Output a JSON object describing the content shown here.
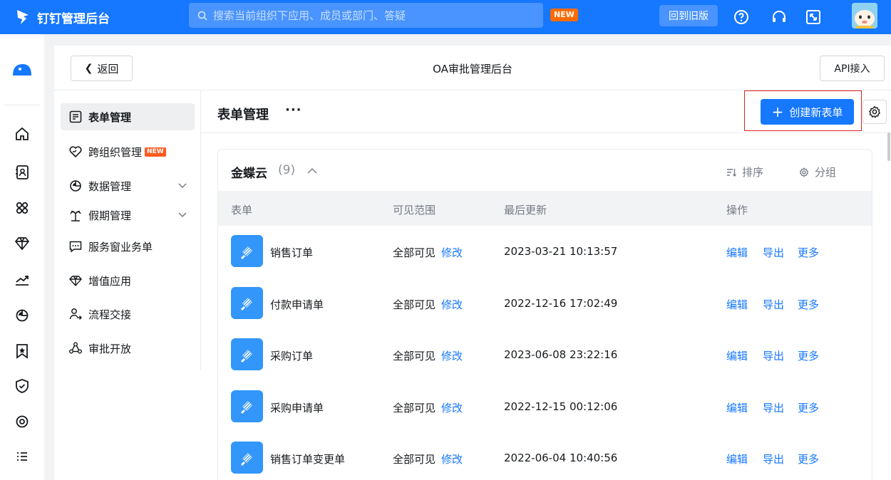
{
  "topbar": {
    "brand": "钉钉管理后台",
    "search_placeholder": "搜索当前组织下应用、成员或部门、答疑",
    "new_badge": "NEW",
    "old_version_label": "回到旧版",
    "icons": [
      "help-icon",
      "headset-icon",
      "fullscreen-icon"
    ],
    "accent_color": "#1677ff"
  },
  "rail": {
    "icons": [
      "home-icon",
      "contacts-icon",
      "apps-icon",
      "diamond-icon",
      "trend-icon",
      "pie-icon",
      "bookmark-icon",
      "shield-icon",
      "target-icon",
      "list-icon"
    ]
  },
  "header": {
    "back_label": "返回",
    "title": "OA审批管理后台",
    "api_label": "API接入"
  },
  "subnav": {
    "items": [
      {
        "label": "表单管理",
        "icon": "form-icon",
        "active": true
      },
      {
        "label": "跨组织管理",
        "icon": "heart-link-icon",
        "badge": "NEW"
      },
      {
        "label": "数据管理",
        "icon": "chart-icon",
        "expandable": true
      },
      {
        "label": "假期管理",
        "icon": "palm-icon",
        "expandable": true
      },
      {
        "label": "服务窗业务单",
        "icon": "chat-icon"
      },
      {
        "label": "增值应用",
        "icon": "diamond-icon"
      },
      {
        "label": "流程交接",
        "icon": "user-transfer-icon"
      },
      {
        "label": "审批开放",
        "icon": "network-icon"
      }
    ]
  },
  "content": {
    "title": "表单管理",
    "more": "···",
    "create_label": "创建新表单",
    "group": {
      "name": "金蝶云",
      "count": "(9)",
      "sort_label": "排序",
      "group_label": "分组",
      "columns": [
        "表单",
        "可见范围",
        "最后更新",
        "操作"
      ],
      "rows": [
        {
          "name": "销售订单",
          "scope": "全部可见",
          "modify": "修改",
          "updated": "2023-03-21 10:13:57",
          "edit": "编辑",
          "export": "导出",
          "more": "更多"
        },
        {
          "name": "付款申请单",
          "scope": "全部可见",
          "modify": "修改",
          "updated": "2022-12-16 17:02:49",
          "edit": "编辑",
          "export": "导出",
          "more": "更多"
        },
        {
          "name": "采购订单",
          "scope": "全部可见",
          "modify": "修改",
          "updated": "2023-06-08 23:22:16",
          "edit": "编辑",
          "export": "导出",
          "more": "更多"
        },
        {
          "name": "采购申请单",
          "scope": "全部可见",
          "modify": "修改",
          "updated": "2022-12-15 00:12:06",
          "edit": "编辑",
          "export": "导出",
          "more": "更多"
        },
        {
          "name": "销售订单变更单",
          "scope": "全部可见",
          "modify": "修改",
          "updated": "2022-06-04 10:40:56",
          "edit": "编辑",
          "export": "导出",
          "more": "更多"
        }
      ]
    }
  }
}
